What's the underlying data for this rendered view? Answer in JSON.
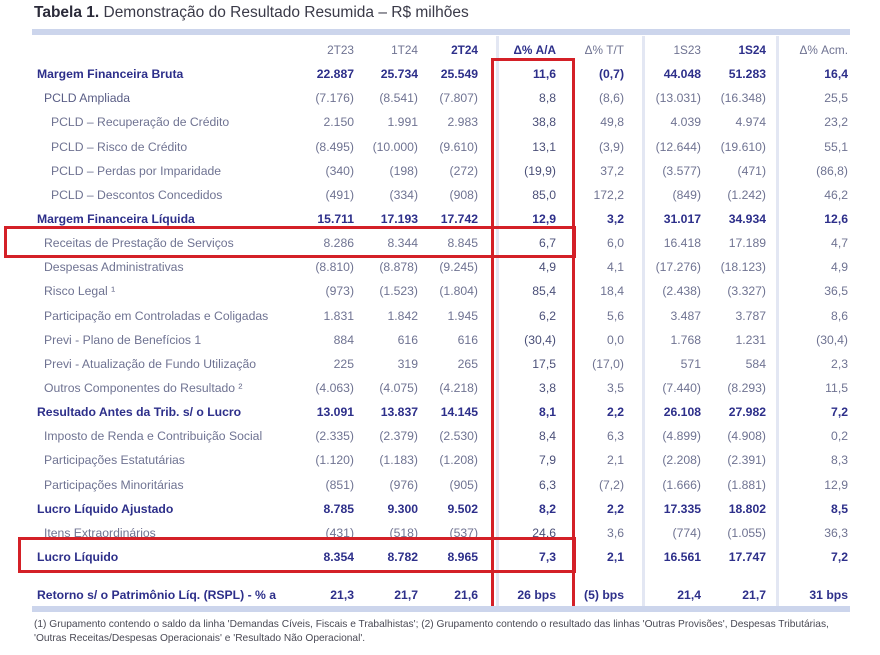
{
  "title": {
    "bold": "Tabela 1.",
    "rest": " Demonstração do Resultado Resumida – R$ milhões"
  },
  "headers": [
    "",
    "2T23",
    "1T24",
    "2T24",
    "Δ% A/A",
    "Δ% T/T",
    "1S23",
    "1S24",
    "Δ% Acm."
  ],
  "rows": [
    {
      "level": 0,
      "label": "Margem Financeira Bruta",
      "values": [
        "22.887",
        "25.734",
        "25.549",
        "11,6",
        "(0,7)",
        "44.048",
        "51.283",
        "16,4"
      ]
    },
    {
      "level": 1,
      "label": "PCLD Ampliada",
      "values": [
        "(7.176)",
        "(8.541)",
        "(7.807)",
        "8,8",
        "(8,6)",
        "(13.031)",
        "(16.348)",
        "25,5"
      ]
    },
    {
      "level": 2,
      "label": "PCLD – Recuperação de Crédito",
      "values": [
        "2.150",
        "1.991",
        "2.983",
        "38,8",
        "49,8",
        "4.039",
        "4.974",
        "23,2"
      ]
    },
    {
      "level": 2,
      "label": "PCLD – Risco de Crédito",
      "values": [
        "(8.495)",
        "(10.000)",
        "(9.610)",
        "13,1",
        "(3,9)",
        "(12.644)",
        "(19.610)",
        "55,1"
      ]
    },
    {
      "level": 2,
      "label": "PCLD – Perdas por Imparidade",
      "values": [
        "(340)",
        "(198)",
        "(272)",
        "(19,9)",
        "37,2",
        "(3.577)",
        "(471)",
        "(86,8)"
      ]
    },
    {
      "level": 2,
      "label": "PCLD – Descontos Concedidos",
      "values": [
        "(491)",
        "(334)",
        "(908)",
        "85,0",
        "172,2",
        "(849)",
        "(1.242)",
        "46,2"
      ]
    },
    {
      "level": 0,
      "label": "Margem Financeira Líquida",
      "values": [
        "15.711",
        "17.193",
        "17.742",
        "12,9",
        "3,2",
        "31.017",
        "34.934",
        "12,6"
      ]
    },
    {
      "level": 3,
      "label": "Receitas de Prestação de Serviços",
      "values": [
        "8.286",
        "8.344",
        "8.845",
        "6,7",
        "6,0",
        "16.418",
        "17.189",
        "4,7"
      ]
    },
    {
      "level": 3,
      "label": "Despesas Administrativas",
      "values": [
        "(8.810)",
        "(8.878)",
        "(9.245)",
        "4,9",
        "4,1",
        "(17.276)",
        "(18.123)",
        "4,9"
      ]
    },
    {
      "level": 3,
      "label": "Risco Legal ¹",
      "values": [
        "(973)",
        "(1.523)",
        "(1.804)",
        "85,4",
        "18,4",
        "(2.438)",
        "(3.327)",
        "36,5"
      ]
    },
    {
      "level": 3,
      "label": "Participação em Controladas e Coligadas",
      "values": [
        "1.831",
        "1.842",
        "1.945",
        "6,2",
        "5,6",
        "3.487",
        "3.787",
        "8,6"
      ]
    },
    {
      "level": 3,
      "label": "Previ - Plano de Benefícios 1",
      "values": [
        "884",
        "616",
        "616",
        "(30,4)",
        "0,0",
        "1.768",
        "1.231",
        "(30,4)"
      ]
    },
    {
      "level": 3,
      "label": "Previ - Atualização de Fundo Utilização",
      "values": [
        "225",
        "319",
        "265",
        "17,5",
        "(17,0)",
        "571",
        "584",
        "2,3"
      ]
    },
    {
      "level": 3,
      "label": "Outros Componentes do Resultado ²",
      "values": [
        "(4.063)",
        "(4.075)",
        "(4.218)",
        "3,8",
        "3,5",
        "(7.440)",
        "(8.293)",
        "11,5"
      ]
    },
    {
      "level": 0,
      "label": "Resultado Antes da Trib. s/ o Lucro",
      "values": [
        "13.091",
        "13.837",
        "14.145",
        "8,1",
        "2,2",
        "26.108",
        "27.982",
        "7,2"
      ]
    },
    {
      "level": 3,
      "label": "Imposto de Renda e Contribuição Social",
      "values": [
        "(2.335)",
        "(2.379)",
        "(2.530)",
        "8,4",
        "6,3",
        "(4.899)",
        "(4.908)",
        "0,2"
      ]
    },
    {
      "level": 3,
      "label": "Participações Estatutárias",
      "values": [
        "(1.120)",
        "(1.183)",
        "(1.208)",
        "7,9",
        "2,1",
        "(2.208)",
        "(2.391)",
        "8,3"
      ]
    },
    {
      "level": 3,
      "label": "Participações Minoritárias",
      "values": [
        "(851)",
        "(976)",
        "(905)",
        "6,3",
        "(7,2)",
        "(1.666)",
        "(1.881)",
        "12,9"
      ]
    },
    {
      "level": 0,
      "label": "Lucro Líquido Ajustado",
      "values": [
        "8.785",
        "9.300",
        "9.502",
        "8,2",
        "2,2",
        "17.335",
        "18.802",
        "8,5"
      ]
    },
    {
      "level": 3,
      "label": "Itens Extraordinários",
      "values": [
        "(431)",
        "(518)",
        "(537)",
        "24,6",
        "3,6",
        "(774)",
        "(1.055)",
        "36,3"
      ]
    },
    {
      "level": 0,
      "label": "Lucro Líquido",
      "values": [
        "8.354",
        "8.782",
        "8.965",
        "7,3",
        "2,1",
        "16.561",
        "17.747",
        "7,2"
      ]
    },
    {
      "level": 9,
      "label": "Retorno s/ o Patrimônio Líq. (RSPL) - % a",
      "values": [
        "21,3",
        "21,7",
        "21,6",
        "26 bps",
        "(5) bps",
        "21,4",
        "21,7",
        "31 bps"
      ]
    }
  ],
  "footnote": "(1) Grupamento contendo o saldo da linha 'Demandas Cíveis, Fiscais e Trabalhistas'; (2) Grupamento contendo o resultado das linhas 'Outras Provisões', Despesas Tributárias, 'Outras Receitas/Despesas Operacionais' e 'Resultado Não Operacional'.",
  "colors": {
    "navy": "#2d2f8a",
    "gray_text": "#6f7392",
    "highlight_red": "#d42027",
    "band": "#ccd5ec"
  }
}
